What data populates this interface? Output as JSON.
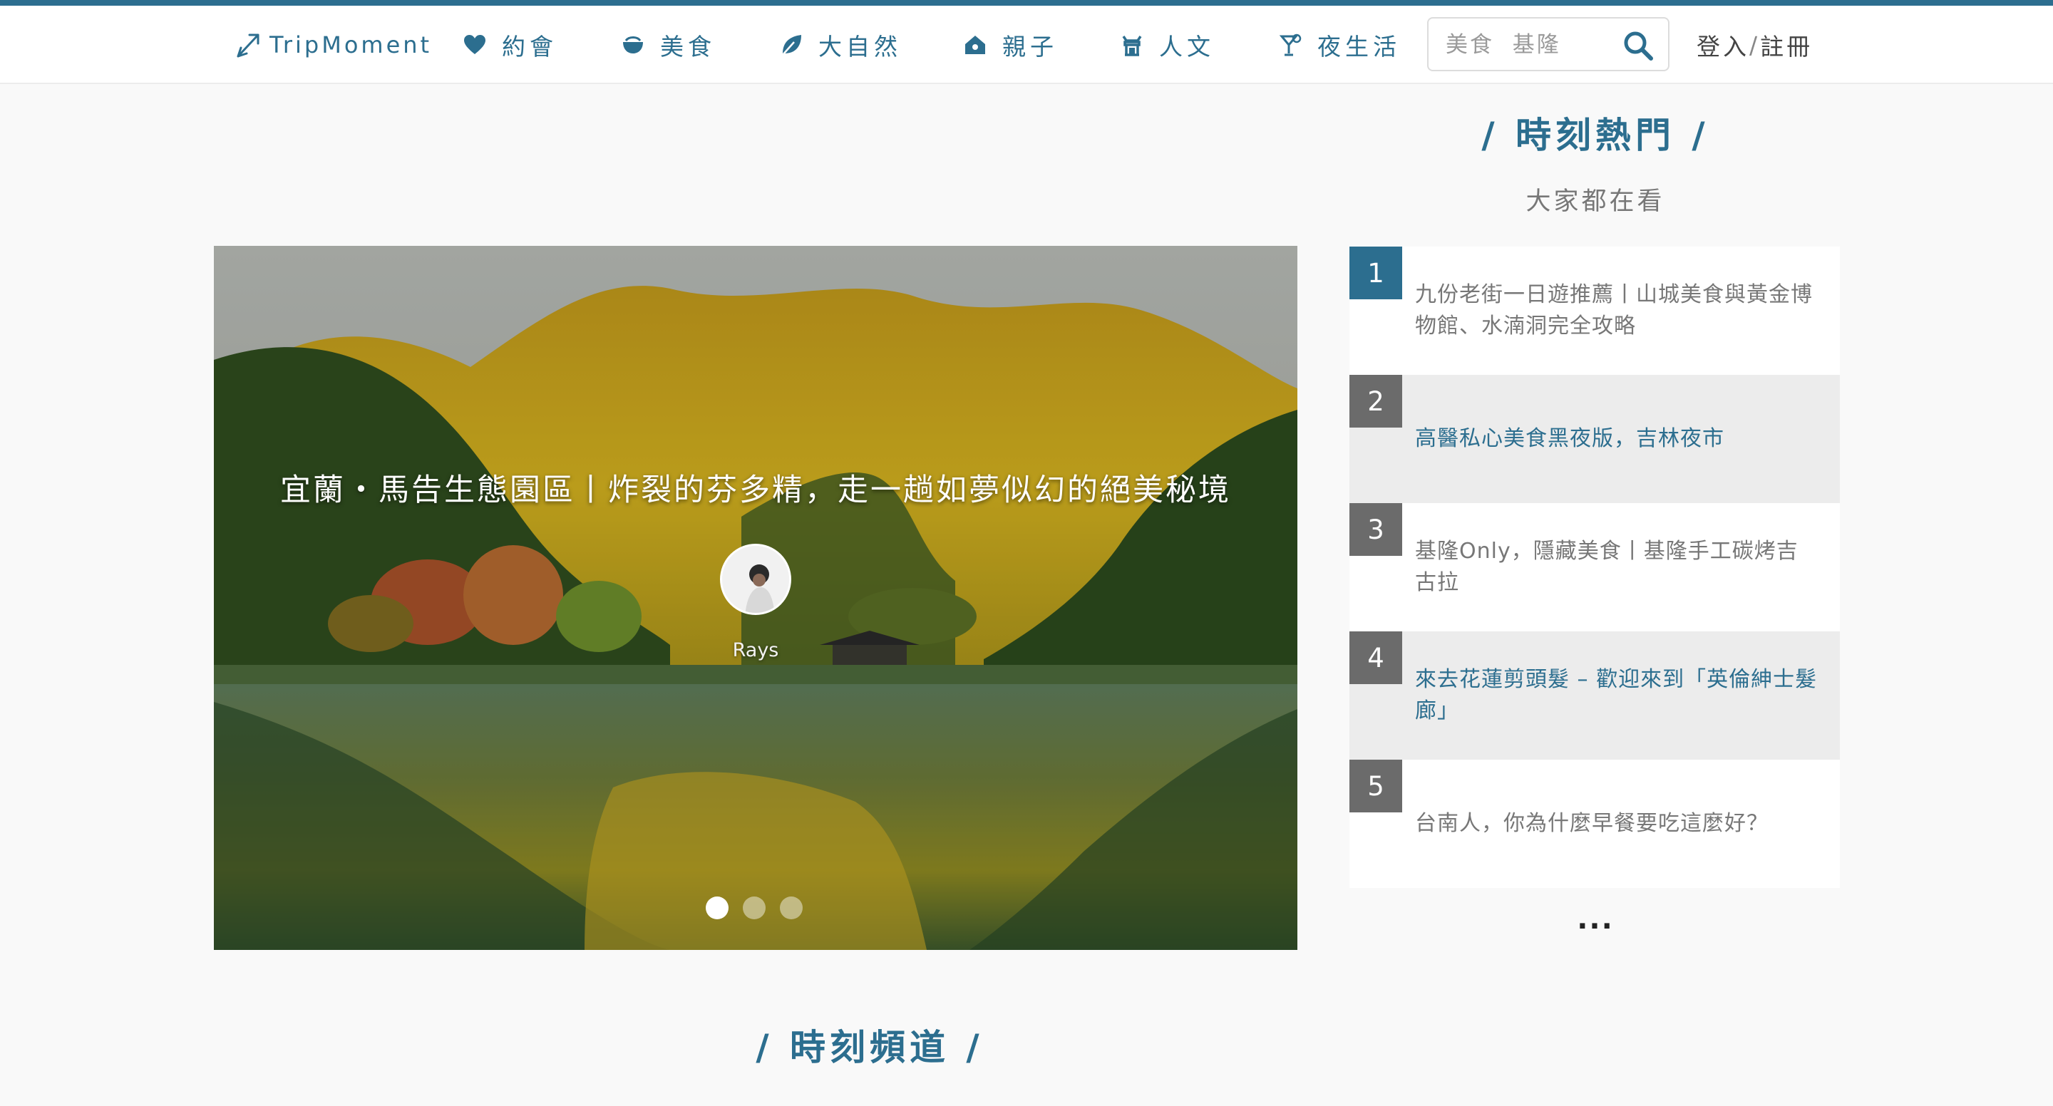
{
  "brand": {
    "name": "TripMoment",
    "accent_color": "#2c6e8f"
  },
  "nav": {
    "items": [
      {
        "label": "約會",
        "icon": "heart-icon"
      },
      {
        "label": "美食",
        "icon": "bowl-icon"
      },
      {
        "label": "大自然",
        "icon": "leaf-icon"
      },
      {
        "label": "親子",
        "icon": "house-icon"
      },
      {
        "label": "人文",
        "icon": "temple-icon"
      },
      {
        "label": "夜生活",
        "icon": "cocktail-icon"
      }
    ],
    "search_placeholder": "美食  基隆",
    "login_label": "登入",
    "separator": "/",
    "register_label": "註冊"
  },
  "hero": {
    "title": "宜蘭・馬告生態園區丨炸裂的芬多精，走一趟如夢似幻的絕美秘境",
    "author": "Rays",
    "slide_count": 3,
    "active_slide": 1
  },
  "popular": {
    "title": "/ 時刻熱門 /",
    "subtitle": "大家都在看",
    "items": [
      {
        "rank": "1",
        "text": "九份老街一日遊推薦丨山城美食與黃金博物館、水湳洞完全攻略"
      },
      {
        "rank": "2",
        "text": "高醫私心美食黑夜版，吉林夜市"
      },
      {
        "rank": "3",
        "text": "基隆Only，隱藏美食丨基隆手工碳烤吉古拉"
      },
      {
        "rank": "4",
        "text": "來去花蓮剪頭髮 – 歡迎來到「英倫紳士髮廊」"
      },
      {
        "rank": "5",
        "text": "台南人，你為什麼早餐要吃這麼好？"
      }
    ],
    "more_label": "..."
  },
  "channels": {
    "title": "/ 時刻頻道 /"
  }
}
